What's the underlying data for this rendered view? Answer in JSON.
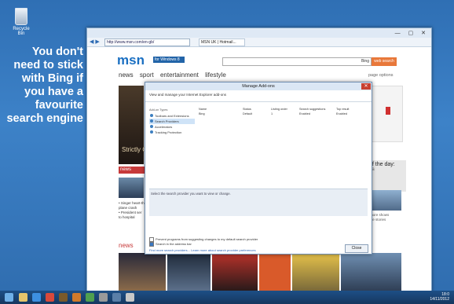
{
  "desktop": {
    "recycle_label": "Recycle Bin",
    "caption": "You don't need to stick with Bing if you have a favourite search engine"
  },
  "browser": {
    "address": "http://www.msn.com/en-gb/",
    "tab_title": "MSN UK | Hotmail...",
    "window_controls": "— ▢ ✕",
    "msn": {
      "logo": "msn",
      "windows_badge": "for Windows 8",
      "search_text": "Bing",
      "search_button": "web search",
      "nav": [
        "news",
        "sport",
        "entertainment",
        "lifestyle"
      ],
      "page_options": "page options",
      "strictly": "Strictly C",
      "news_label": "news",
      "news_items": [
        "• Singer heart-th plane crash",
        "• President ser to hospital"
      ],
      "news_bottom": "news",
      "day_title": "of the day:",
      "day_sub": "na",
      "right_text": [
        "more shows",
        "lite stories"
      ]
    }
  },
  "dialog": {
    "title": "Manage Add-ons",
    "description": "View and manage your Internet Explorer add-ons",
    "addon_types_header": "Add-on Types",
    "addon_types": [
      "Toolbars and Extensions",
      "Search Providers",
      "Accelerators",
      "Tracking Protection"
    ],
    "selected_index": 1,
    "columns": [
      "Name",
      "Status",
      "Listing order",
      "Search suggestions",
      "Top result"
    ],
    "rows": [
      [
        "Bing",
        "Default",
        "1",
        "Enabled",
        "Enabled"
      ]
    ],
    "panel_hint": "Select the search provider you want to view or change.",
    "checks": [
      {
        "label": "Prevent programs from suggesting changes to my default search provider",
        "checked": false
      },
      {
        "label": "Search in the address bar",
        "checked": true
      }
    ],
    "links": "Find more search providers... Learn more about search provider preferences",
    "close_button": "Close"
  },
  "taskbar": {
    "time": "18:0",
    "date": "14/11/2012"
  },
  "colors": {
    "desktop": "#3d82c8",
    "msn_blue": "#1a6fc2",
    "search_orange": "#e8783a",
    "news_red": "#c73a3a",
    "taskbar": "#1d4f86"
  }
}
